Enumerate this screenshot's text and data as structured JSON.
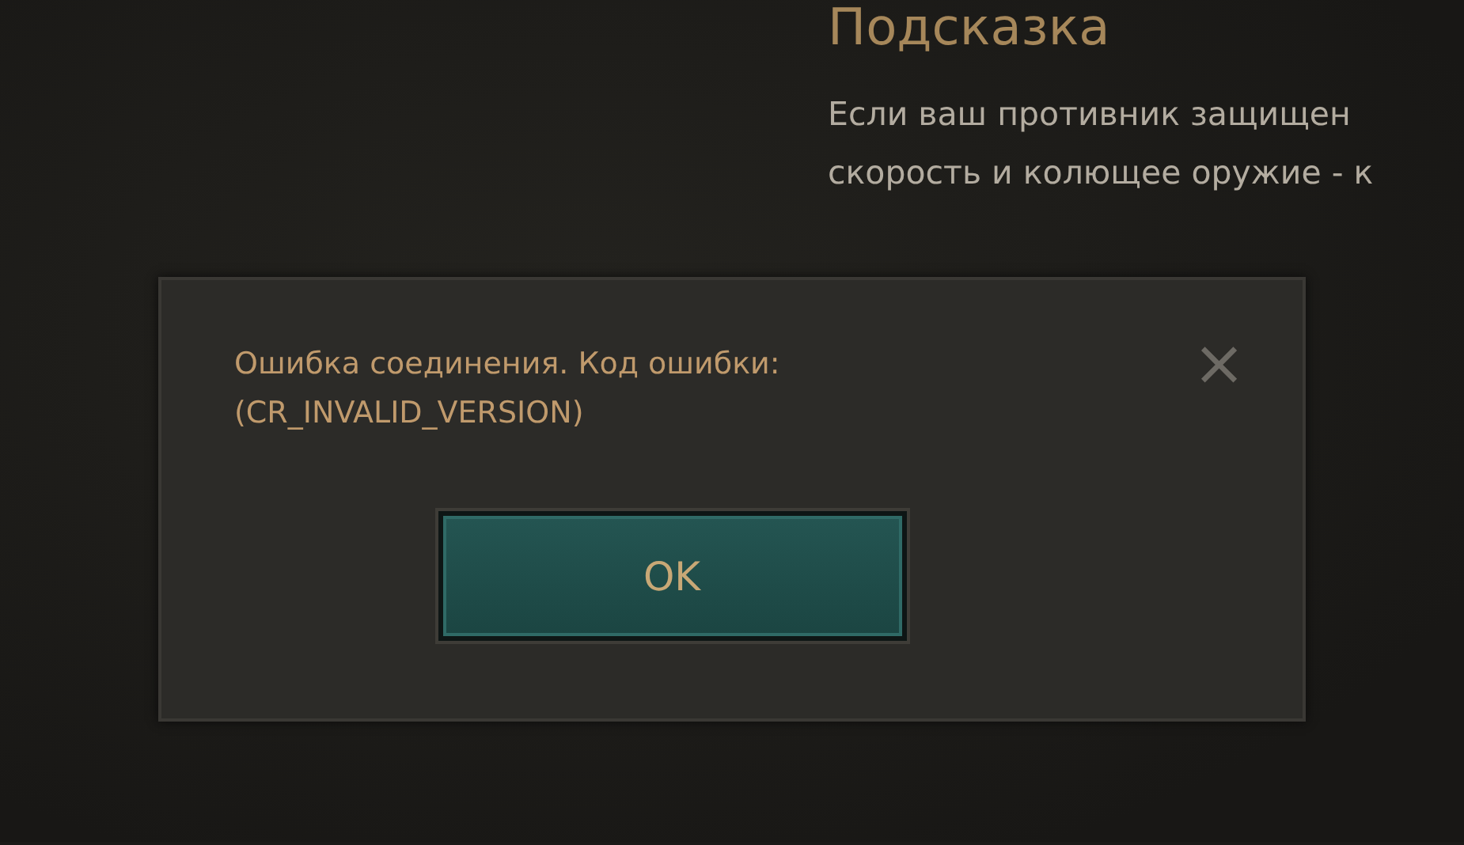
{
  "hint": {
    "title": "Подсказка",
    "lines": [
      "Если ваш противник защищен",
      "скорость и колющее оружие - к"
    ]
  },
  "dialog": {
    "message": [
      "Ошибка соединения. Код ошибки:",
      "(CR_INVALID_VERSION)"
    ],
    "close": "×",
    "button": "OK"
  }
}
